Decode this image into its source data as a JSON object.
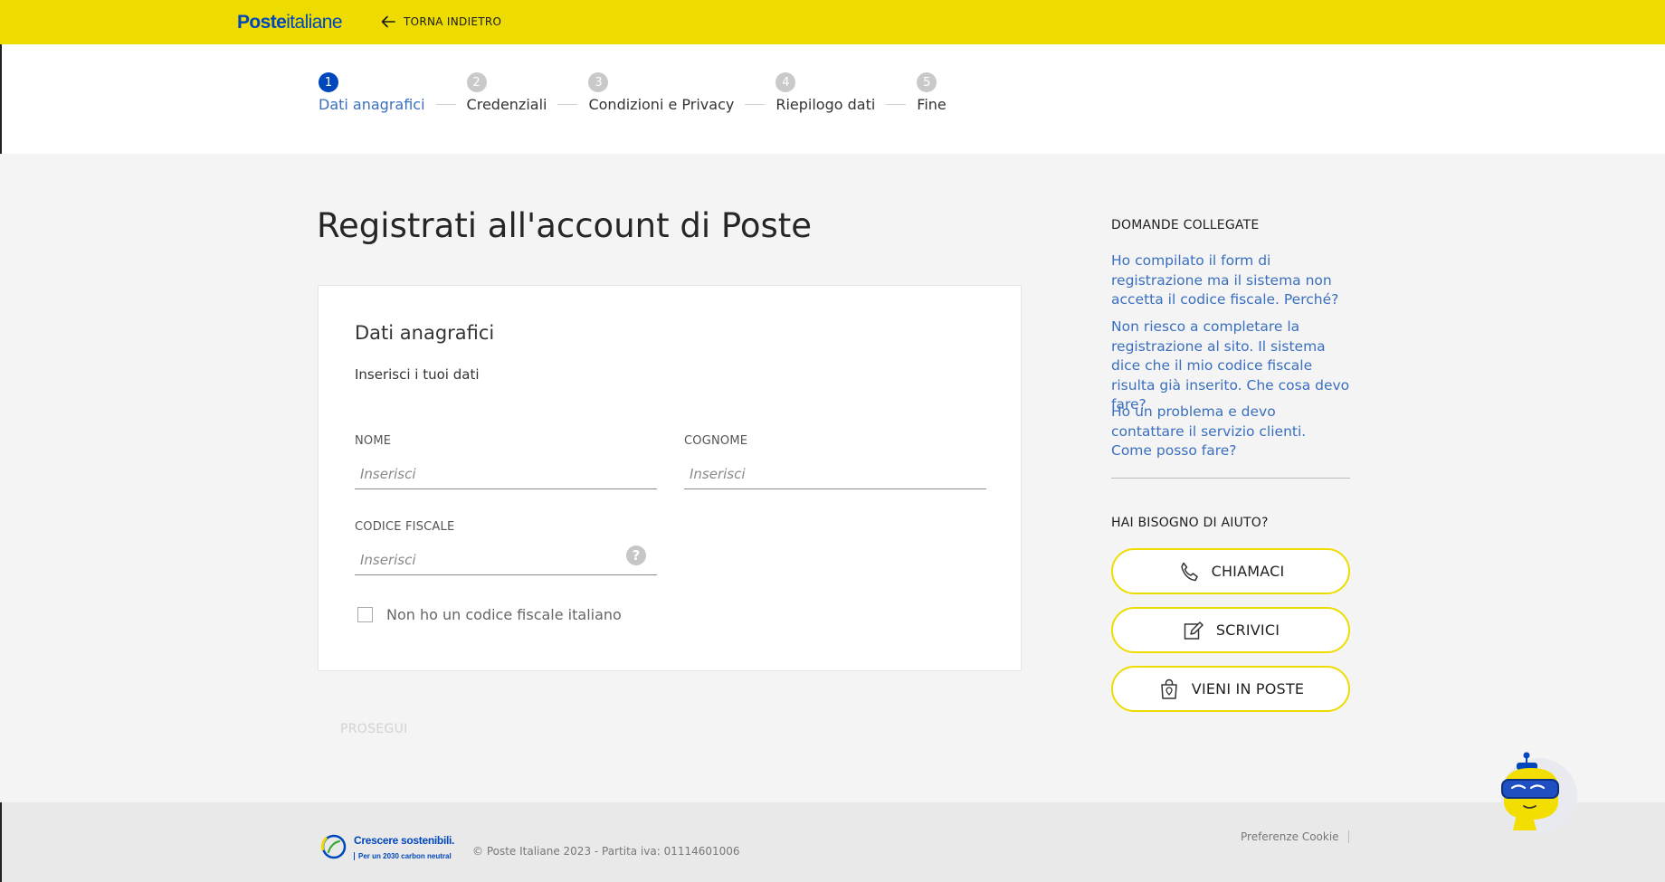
{
  "header": {
    "logo_bold": "Poste",
    "logo_light": "italiane",
    "back_label": "TORNA INDIETRO"
  },
  "stepper": {
    "steps": [
      {
        "num": "1",
        "label": "Dati anagrafici",
        "active": true
      },
      {
        "num": "2",
        "label": "Credenziali",
        "active": false
      },
      {
        "num": "3",
        "label": "Condizioni e Privacy",
        "active": false
      },
      {
        "num": "4",
        "label": "Riepilogo dati",
        "active": false
      },
      {
        "num": "5",
        "label": "Fine",
        "active": false
      }
    ]
  },
  "main": {
    "title": "Registrati all'account di Poste",
    "card": {
      "title": "Dati anagrafici",
      "subtitle": "Inserisci i tuoi dati",
      "fields": {
        "nome": {
          "label": "NOME",
          "placeholder": "Inserisci",
          "value": ""
        },
        "cognome": {
          "label": "COGNOME",
          "placeholder": "Inserisci",
          "value": ""
        },
        "codice_fiscale": {
          "label": "CODICE FISCALE",
          "placeholder": "Inserisci",
          "value": "",
          "help": "?"
        }
      },
      "checkbox_label": "Non ho un codice fiscale italiano"
    },
    "submit_label": "PROSEGUI"
  },
  "sidebar": {
    "faq_heading": "DOMANDE COLLEGATE",
    "faqs": [
      "Ho compilato il form di registrazione ma il sistema non accetta il codice fiscale. Perché?",
      "Non riesco a completare la registrazione al sito. Il sistema dice che il mio codice fiscale risulta già inserito. Che cosa devo fare?",
      "Ho un problema e devo contattare il servizio clienti. Come posso fare?"
    ],
    "help_heading": "HAI BISOGNO DI AIUTO?",
    "buttons": {
      "call": "CHIAMACI",
      "write": "SCRIVICI",
      "visit": "VIENI IN POSTE"
    }
  },
  "footer": {
    "sustainability_title": "Crescere sostenibili.",
    "sustainability_sub": "Per un 2030 carbon neutral",
    "copyright": "© Poste Italiane 2023 - Partita iva: 01114601006",
    "cookie": "Preferenze Cookie"
  },
  "colors": {
    "brand_yellow": "#eedc00",
    "brand_blue": "#0047bb",
    "link_blue": "#3a6fbf"
  }
}
